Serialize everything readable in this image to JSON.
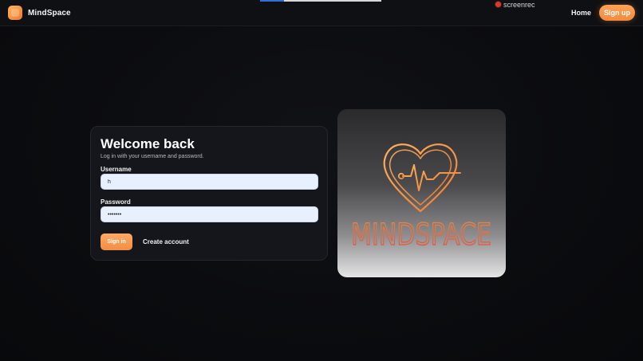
{
  "header": {
    "brand": "MindSpace",
    "nav_home": "Home",
    "nav_signup": "Sign up",
    "recorder_label": "screenrec",
    "recorder_progress": 0.2
  },
  "login": {
    "title": "Welcome back",
    "subtitle": "Log in with your username and password.",
    "username_label": "Username",
    "username_value": "h",
    "password_label": "Password",
    "password_value": "•••••••",
    "signin_label": "Sign in",
    "create_account_label": "Create account"
  },
  "logo": {
    "wordmark": "MINDSPACE",
    "icon": "heart-pulse-icon"
  },
  "colors": {
    "accent": "#f28d44",
    "accent_light": "#ffa961",
    "wordmark_orange": "#f2853c",
    "wordmark_red": "#e0483a"
  }
}
